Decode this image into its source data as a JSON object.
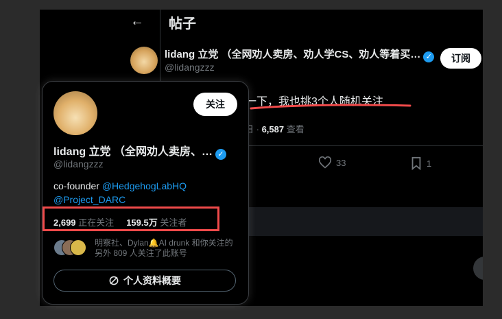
{
  "header": {
    "title": "帖子"
  },
  "post": {
    "author_name": "lidang 立党 （全网劝人卖房、劝人学CS、劝人等着买…",
    "author_handle": "@lidangzzz",
    "subscribe_label": "订阅",
    "text": "注一下，我也挑3个人随机关注",
    "meta_suffix": "日 · ",
    "views": "6,587",
    "views_label": "查看",
    "likes": "33",
    "bookmarks": "1"
  },
  "hover_card": {
    "follow_label": "关注",
    "name": "lidang 立党 （全网劝人卖房、…",
    "handle": "@lidangzzz",
    "bio_prefix": "co-founder ",
    "bio_link1": "@HedgehogLabHQ",
    "bio_link2": "@Project_DARC",
    "following_count": "2,699",
    "following_label": "正在关注",
    "followers_count": "159.5万",
    "followers_label": "关注者",
    "followers_you_know": "明察社、Dylan🔔AI drunk 和你关注的另外 809 人关注了此账号",
    "profile_summary_label": "个人资料概要"
  },
  "colors": {
    "accent": "#1d9bf0",
    "highlight": "#f04a4a",
    "background": "#000000"
  }
}
